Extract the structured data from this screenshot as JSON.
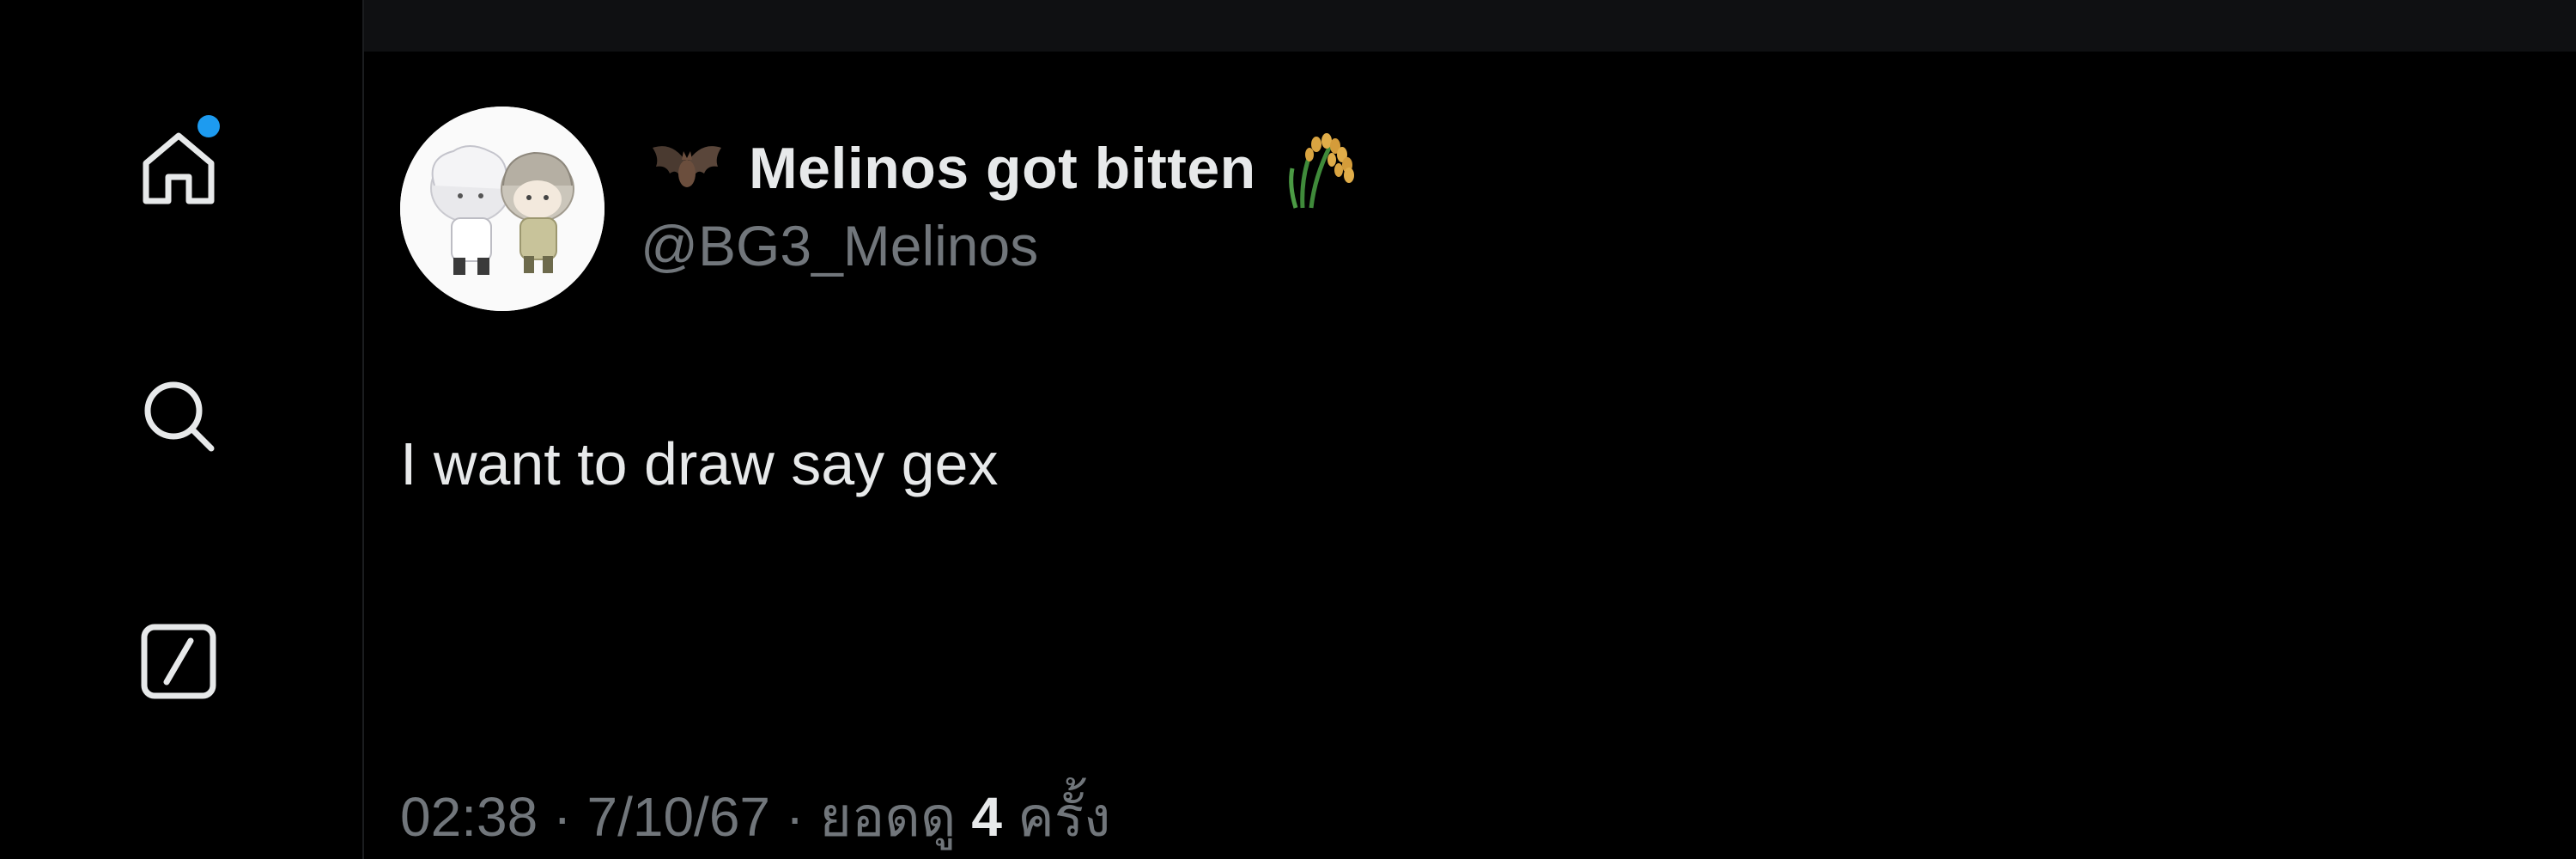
{
  "sidebar": {
    "items": [
      {
        "icon": "home-icon",
        "has_notification": true
      },
      {
        "icon": "search-icon"
      },
      {
        "icon": "compose-icon"
      }
    ],
    "notification_dot_color": "#1d9bf0"
  },
  "tweet": {
    "author": {
      "display_name": "Melinos got bitten",
      "name_prefix_emoji": "bat-emoji-icon",
      "name_suffix_emoji": "rice-sheaf-emoji-icon",
      "handle": "@BG3_Melinos"
    },
    "text": "I want to draw say gex",
    "meta": {
      "time": "02:38",
      "separator": "·",
      "date": "7/10/67",
      "views_label": "ยอดดู",
      "views_count": "4",
      "views_unit": "ครั้ง"
    }
  },
  "colors": {
    "background": "#000000",
    "header": "#0f1012",
    "primary_text": "#e7e9ea",
    "secondary_text": "#71767b",
    "accent": "#1d9bf0"
  }
}
